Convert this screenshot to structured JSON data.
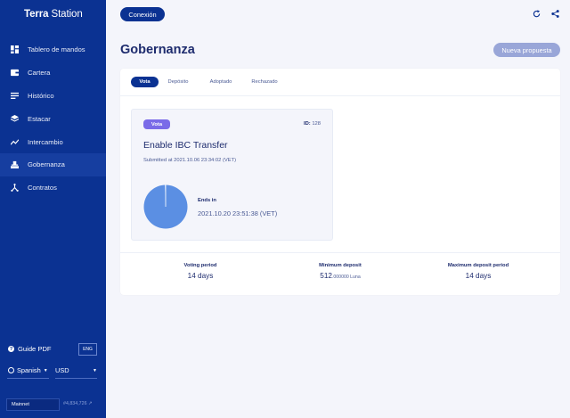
{
  "brand": {
    "part1": "Terra",
    "part2": " Station"
  },
  "sidebar": {
    "items": [
      {
        "label": "Tablero de mandos",
        "icon": "dashboard-icon"
      },
      {
        "label": "Cartera",
        "icon": "wallet-icon"
      },
      {
        "label": "Histórico",
        "icon": "history-icon"
      },
      {
        "label": "Estacar",
        "icon": "stake-icon"
      },
      {
        "label": "Intercambio",
        "icon": "swap-icon"
      },
      {
        "label": "Gobernanza",
        "icon": "governance-icon",
        "active": true
      },
      {
        "label": "Contratos",
        "icon": "contracts-icon"
      }
    ],
    "guide_label": "Guide PDF",
    "guide_lang": "ENG",
    "language": "Spanish",
    "currency": "USD",
    "network": "Mainnet",
    "block_height": "#4,834,726"
  },
  "header": {
    "connect_label": "Conexión"
  },
  "page": {
    "title": "Gobernanza",
    "new_proposal_label": "Nueva propuesta"
  },
  "tabs": [
    "Vota",
    "Depósito",
    "Adoptado",
    "Rechazado"
  ],
  "proposal": {
    "status": "Vota",
    "id_label": "ID:",
    "id_value": " 128",
    "title": "Enable IBC Transfer",
    "submitted": "Submitted at 2021.10.06 23:34:02 (VET)",
    "ends_label": "Ends in",
    "ends_date": "2021.10.20 23:51:38 (VET)",
    "progress_fraction": 0.995
  },
  "stats": {
    "voting_label": "Voting period",
    "voting_value": "14 days",
    "min_deposit_label": "Minimum deposit",
    "min_deposit_int": "512",
    "min_deposit_dec": ".000000 Luna",
    "max_deposit_label": "Maximum deposit period",
    "max_deposit_value": "14 days"
  },
  "colors": {
    "sidebar": "#0b3292",
    "accent": "#0b3292",
    "badge": "#7a6be8",
    "pie": "#5b8fe3"
  }
}
